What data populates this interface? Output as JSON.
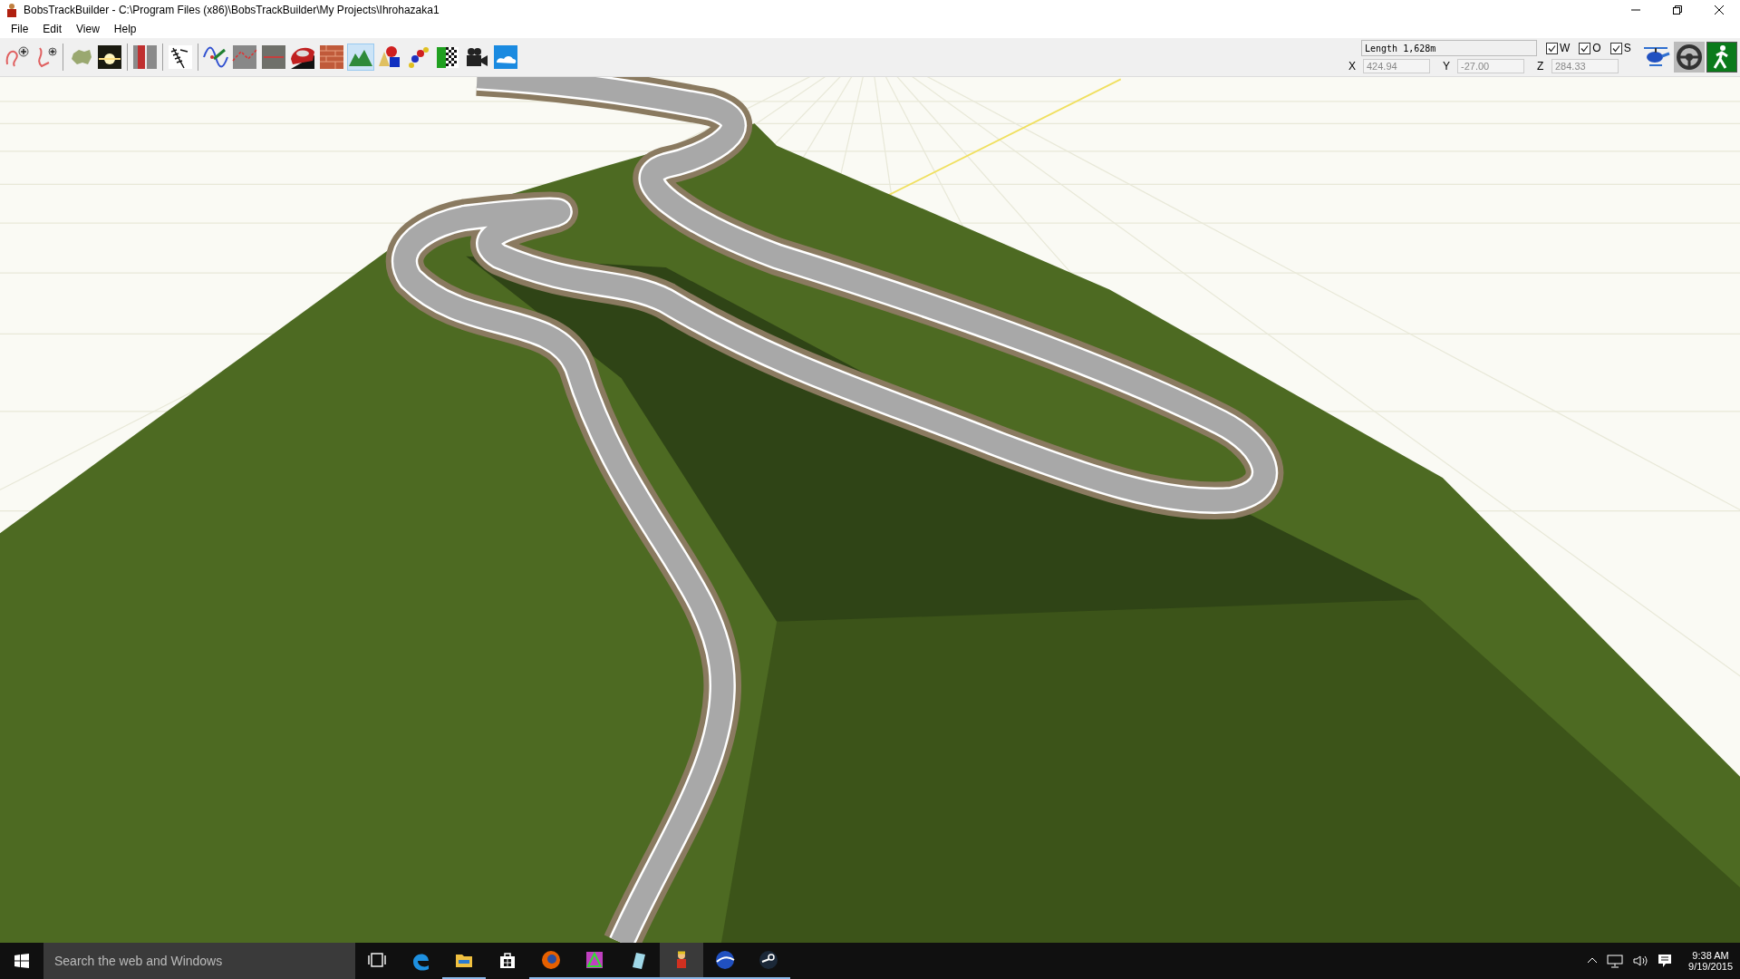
{
  "window": {
    "title": "BobsTrackBuilder - C:\\Program Files (x86)\\BobsTrackBuilder\\My Projects\\Ihrohazaka1"
  },
  "menu": [
    "File",
    "Edit",
    "View",
    "Help"
  ],
  "toolbar": [
    {
      "kind": "trackadd",
      "selected": false
    },
    {
      "kind": "pathadd",
      "selected": false
    },
    {
      "kind": "separator"
    },
    {
      "kind": "map",
      "selected": false
    },
    {
      "kind": "sun",
      "selected": false
    },
    {
      "kind": "separator"
    },
    {
      "kind": "wall",
      "selected": false
    },
    {
      "kind": "separator"
    },
    {
      "kind": "fence",
      "selected": false
    },
    {
      "kind": "separator"
    },
    {
      "kind": "curve",
      "selected": false
    },
    {
      "kind": "roadpoints",
      "selected": false
    },
    {
      "kind": "roadwidth",
      "selected": false
    },
    {
      "kind": "car",
      "selected": false
    },
    {
      "kind": "bricks",
      "selected": false
    },
    {
      "kind": "terrain",
      "selected": true
    },
    {
      "kind": "objects",
      "selected": false
    },
    {
      "kind": "joints",
      "selected": false
    },
    {
      "kind": "flag",
      "selected": false
    },
    {
      "kind": "camera",
      "selected": false
    },
    {
      "kind": "sky",
      "selected": false
    }
  ],
  "info": {
    "length": "Length 1,628m",
    "toggles": [
      {
        "label": "W",
        "checked": true
      },
      {
        "label": "O",
        "checked": true
      },
      {
        "label": "S",
        "checked": true
      }
    ],
    "coords": [
      {
        "label": "X",
        "value": "424.94"
      },
      {
        "label": "Y",
        "value": "-27.00"
      },
      {
        "label": "Z",
        "value": "284.33"
      }
    ]
  },
  "view_modes": [
    {
      "kind": "helicopter",
      "selected": false
    },
    {
      "kind": "wheel",
      "selected": false
    },
    {
      "kind": "walker",
      "selected": true
    }
  ],
  "taskbar": {
    "search": {
      "placeholder": "Search the web and Windows"
    },
    "apps": [
      {
        "kind": "taskview",
        "running": false,
        "selected": false
      },
      {
        "kind": "edge",
        "running": false,
        "selected": false
      },
      {
        "kind": "explorer",
        "running": true,
        "selected": false
      },
      {
        "kind": "store",
        "running": false,
        "selected": false
      },
      {
        "kind": "firefox",
        "running": true,
        "selected": false
      },
      {
        "kind": "builder3d",
        "running": true,
        "selected": false
      },
      {
        "kind": "notepad",
        "running": true,
        "selected": false
      },
      {
        "kind": "bobs",
        "running": true,
        "selected": true
      },
      {
        "kind": "globe",
        "running": true,
        "selected": false
      },
      {
        "kind": "steam",
        "running": true,
        "selected": false
      }
    ],
    "time": "9:38 AM",
    "date": "9/19/2015"
  }
}
